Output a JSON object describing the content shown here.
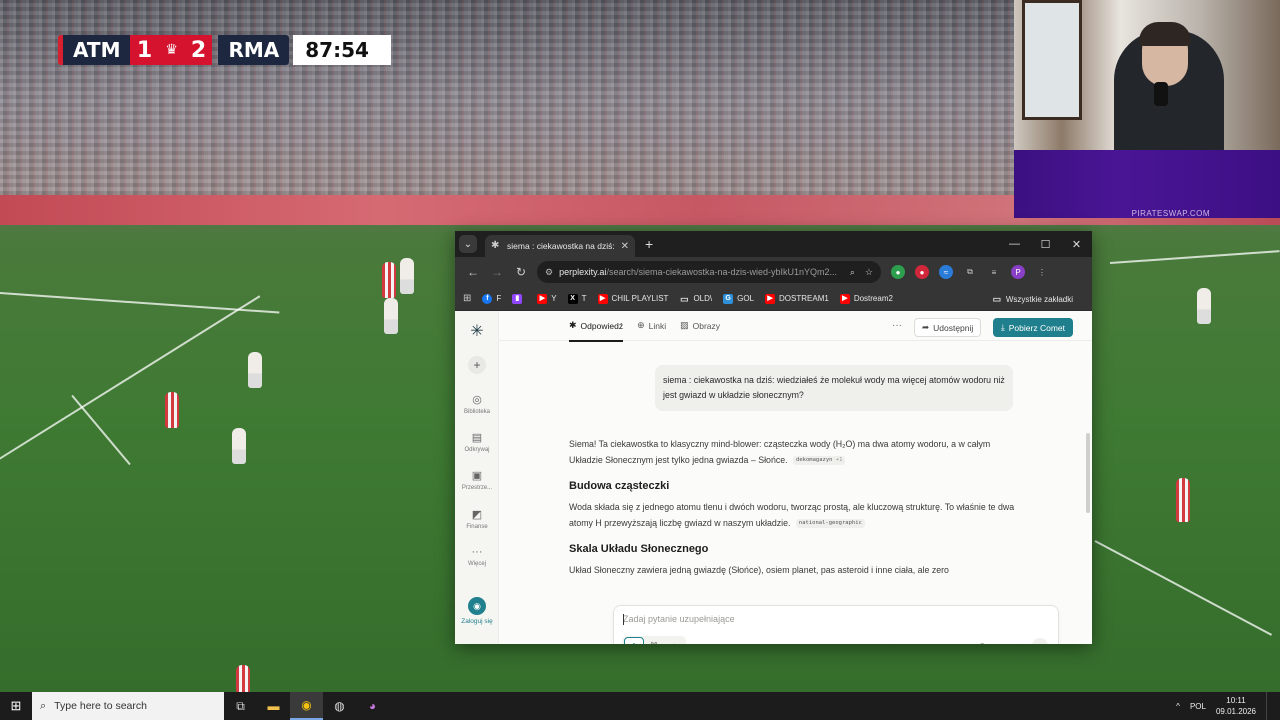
{
  "scoreboard": {
    "home_team": "ATM",
    "home_score": "1",
    "away_score": "2",
    "away_team": "RMA",
    "match_clock": "87:54"
  },
  "overlay": {
    "watermark": "PIRATESWAP.COM"
  },
  "browser": {
    "tab_title": "siema : ciekawostka na dziś: wie",
    "url_host": "perplexity.ai",
    "url_path": "/search/siema-ciekawostka-na-dzis-wied-ybIkU1nYQm2...",
    "bookmarks": [
      {
        "label": "F",
        "color": "#1877f2",
        "icon": "facebook-icon"
      },
      {
        "label": "",
        "color": "#9146ff",
        "icon": "twitch-icon"
      },
      {
        "label": "Y",
        "color": "#ff0000",
        "icon": "youtube-icon"
      },
      {
        "label": "T",
        "color": "#000000",
        "icon": "x-icon"
      },
      {
        "label": "CHIL PLAYLIST",
        "color": "#ff0000",
        "icon": "youtube-icon"
      },
      {
        "label": "OLD\\",
        "color": "#555555",
        "icon": "folder-icon"
      },
      {
        "label": "GOL",
        "color": "#2f8fd8",
        "icon": "site-icon"
      },
      {
        "label": "DOSTREAM1",
        "color": "#ff0000",
        "icon": "youtube-icon"
      },
      {
        "label": "Dostream2",
        "color": "#ff0000",
        "icon": "youtube-icon"
      }
    ],
    "all_bookmarks": "Wszystkie zakładki"
  },
  "perplexity": {
    "sidebar": [
      {
        "label": "Biblioteka",
        "icon": "library-icon"
      },
      {
        "label": "Odkrywaj",
        "icon": "discover-icon"
      },
      {
        "label": "Przestrze...",
        "icon": "spaces-icon"
      },
      {
        "label": "Finanse",
        "icon": "finance-icon"
      },
      {
        "label": "Więcej",
        "icon": "more-icon"
      }
    ],
    "login_label": "Zaloguj się",
    "tabs": [
      {
        "label": "Odpowiedź",
        "icon": "answer-icon",
        "active": true
      },
      {
        "label": "Linki",
        "icon": "globe-icon",
        "active": false
      },
      {
        "label": "Obrazy",
        "icon": "image-icon",
        "active": false
      }
    ],
    "share_label": "Udostępnij",
    "comet_label": "Pobierz Comet",
    "question": "siema : ciekawostka na dziś: wiedziałeś że molekuł wody ma więcej atomów wodoru niż jest gwiazd w układzie słonecznym?",
    "answer": {
      "intro": "Siema! Ta ciekawostka to klasyczny mind-blower: cząsteczka wody (H₂O) ma dwa atomy wodoru, a w całym Układzie Słonecznym jest tylko jedna gwiazda – Słońce.",
      "cite1": "dekomagazyn",
      "cite1_more": "+1",
      "h1": "Budowa cząsteczki",
      "p1": "Woda składa się z jednego atomu tlenu i dwóch wodoru, tworząc prostą, ale kluczową strukturę. To właśnie te dwa atomy H przewyższają liczbę gwiazd w naszym układzie.",
      "cite2": "national-geographic",
      "h2": "Skala Układu Słonecznego",
      "p2": "Układ Słoneczny zawiera jedną gwiazdę (Słońce), osiem planet, pas asteroid i inne ciała, ale zero"
    },
    "composer_placeholder": "Zadaj pytanie uzupełniające"
  },
  "taskbar": {
    "search_placeholder": "Type here to search",
    "language": "POL",
    "time": "10:11",
    "date": "09.01.2026"
  }
}
